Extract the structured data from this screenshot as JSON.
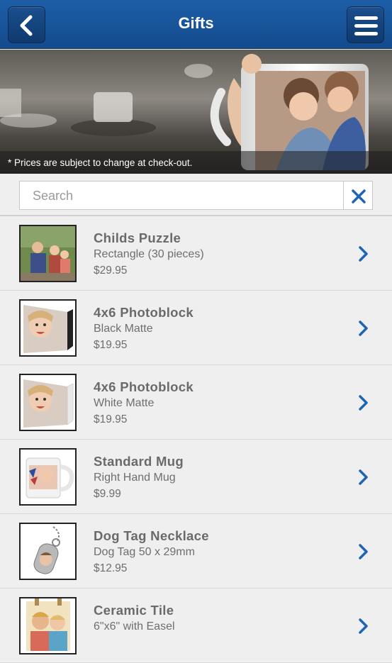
{
  "header": {
    "title": "Gifts",
    "accent": "#1d5ea8"
  },
  "banner": {
    "notice": "* Prices are subject to change at check-out."
  },
  "search": {
    "placeholder": "Search"
  },
  "products": [
    {
      "name": "Childs Puzzle",
      "option": "Rectangle (30 pieces)",
      "price": "$29.95"
    },
    {
      "name": "4x6 Photoblock",
      "option": "Black Matte",
      "price": "$19.95"
    },
    {
      "name": "4x6 Photoblock",
      "option": "White Matte",
      "price": "$19.95"
    },
    {
      "name": "Standard Mug",
      "option": "Right Hand Mug",
      "price": "$9.99"
    },
    {
      "name": "Dog Tag Necklace",
      "option": "Dog Tag 50 x 29mm",
      "price": "$12.95"
    },
    {
      "name": "Ceramic Tile",
      "option": "6\"x6\" with Easel",
      "price": ""
    }
  ]
}
